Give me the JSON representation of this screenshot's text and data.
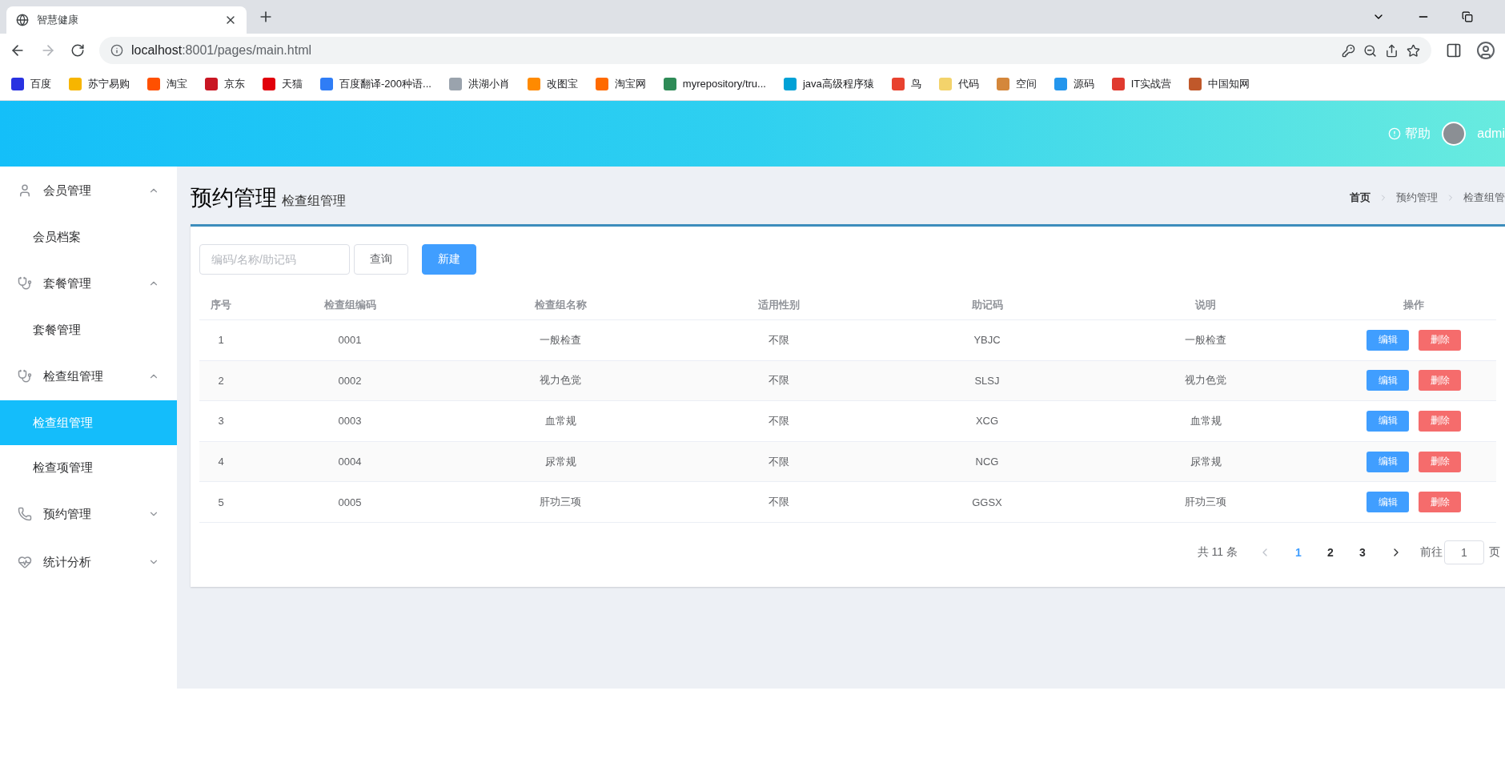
{
  "browser": {
    "tab_title": "智慧健康",
    "url_host": "localhost",
    "url_rest": ":8001/pages/main.html",
    "bookmarks": [
      {
        "label": "百度",
        "color": "#2932e1"
      },
      {
        "label": "苏宁易购",
        "color": "#f7b500"
      },
      {
        "label": "淘宝",
        "color": "#ff5000"
      },
      {
        "label": "京东",
        "color": "#c91623"
      },
      {
        "label": "天猫",
        "color": "#e1000a"
      },
      {
        "label": "百度翻译-200种语...",
        "color": "#2f7df6"
      },
      {
        "label": "洪湖小肖",
        "color": "#9aa3ad"
      },
      {
        "label": "改图宝",
        "color": "#ff8a00"
      },
      {
        "label": "淘宝网",
        "color": "#ff6a00"
      },
      {
        "label": "myrepository/tru...",
        "color": "#2e8b57"
      },
      {
        "label": "java高级程序猿",
        "color": "#00a1d6"
      },
      {
        "label": "鸟",
        "color": "#e8422f"
      },
      {
        "label": "代码",
        "color": "#f3d36b"
      },
      {
        "label": "空间",
        "color": "#d4873b"
      },
      {
        "label": "源码",
        "color": "#2496ed"
      },
      {
        "label": "IT实战营",
        "color": "#e03a2f"
      },
      {
        "label": "中国知网",
        "color": "#c0582a"
      }
    ]
  },
  "header": {
    "help": "帮助",
    "user": "admi"
  },
  "sidebar": [
    {
      "label": "会员管理",
      "expanded": true,
      "children": [
        {
          "label": "会员档案",
          "selected": false
        }
      ]
    },
    {
      "label": "套餐管理",
      "expanded": true,
      "children": [
        {
          "label": "套餐管理",
          "selected": false
        }
      ]
    },
    {
      "label": "检查组管理",
      "expanded": true,
      "children": [
        {
          "label": "检查组管理",
          "selected": true
        },
        {
          "label": "检查项管理",
          "selected": false
        }
      ]
    },
    {
      "label": "预约管理",
      "expanded": false
    },
    {
      "label": "统计分析",
      "expanded": false
    }
  ],
  "page": {
    "title": "预约管理",
    "subtitle": "检查组管理",
    "breadcrumb": [
      "首页",
      "预约管理",
      "检查组管"
    ]
  },
  "toolbar": {
    "search_placeholder": "编码/名称/助记码",
    "query": "查询",
    "create": "新建"
  },
  "table": {
    "columns": [
      "序号",
      "检查组编码",
      "检查组名称",
      "适用性别",
      "助记码",
      "说明",
      "操作"
    ],
    "rows": [
      {
        "cells": [
          "1",
          "0001",
          "一般检查",
          "不限",
          "YBJC",
          "一般检查"
        ],
        "edit": "编辑",
        "delete": "删除"
      },
      {
        "cells": [
          "2",
          "0002",
          "视力色觉",
          "不限",
          "SLSJ",
          "视力色觉"
        ],
        "edit": "编辑",
        "delete": "删除"
      },
      {
        "cells": [
          "3",
          "0003",
          "血常规",
          "不限",
          "XCG",
          "血常规"
        ],
        "edit": "编辑",
        "delete": "删除"
      },
      {
        "cells": [
          "4",
          "0004",
          "尿常规",
          "不限",
          "NCG",
          "尿常规"
        ],
        "edit": "编辑",
        "delete": "删除"
      },
      {
        "cells": [
          "5",
          "0005",
          "肝功三项",
          "不限",
          "GGSX",
          "肝功三项"
        ],
        "edit": "编辑",
        "delete": "删除"
      }
    ]
  },
  "pagination": {
    "total": "共 11 条",
    "pages": [
      {
        "label": "1",
        "selected": true
      },
      {
        "label": "2",
        "selected": false
      },
      {
        "label": "3",
        "selected": false
      }
    ],
    "goto": "前往",
    "goto_value": "1",
    "page_unit": "页"
  }
}
